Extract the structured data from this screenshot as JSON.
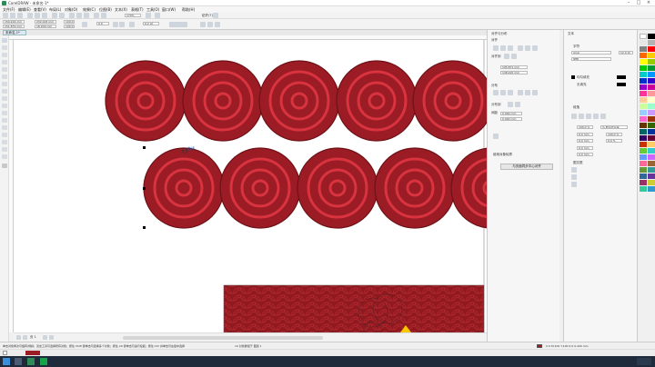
{
  "window": {
    "title": "CorelDRAW - 未命名-1*"
  },
  "menu": [
    "文件(F)",
    "编辑(E)",
    "查看(V)",
    "布局(L)",
    "对象(O)",
    "效果(C)",
    "位图(B)",
    "文本(X)",
    "表格(T)",
    "工具(O)",
    "窗口(W)",
    "帮助(H)"
  ],
  "toolbar": {
    "zoom": "170%",
    "snap_label": "贴齐(T)"
  },
  "propbar": {
    "x": "150.224 mm",
    "y": "151.879 mm",
    "w": "232.003 mm",
    "h": "18.209 mm",
    "sx": "100.0",
    "sy": "100.0",
    "angle": "0.0",
    "outline": "0.2 pt"
  },
  "document_tab": "未命名-1*",
  "canvas": {
    "tooltip": "曲线",
    "circle_fill": "#9b1c24",
    "ring_color": "#d8333f",
    "row1_count": 5,
    "row2_count": 5
  },
  "dock": {
    "title": "对齐与分布",
    "align_label": "对齐",
    "align_to_label": "对齐到",
    "distribute_label": "分布",
    "distribute_to_label": "分布到",
    "align_box1": "195.871 mm",
    "align_box2": "148.220 mm",
    "space_label": "间距",
    "dist_box1": "0.000 mm",
    "dist_box2": "0.000 mm",
    "section3": "使用对象轮廓",
    "apply_button": "与页面同步中心对齐"
  },
  "text_panel": {
    "title": "文本",
    "char_label": "字符",
    "font": "Arial",
    "size": "12.0 pt",
    "style": "常规",
    "fill1": "均匀填充",
    "fill2": "无填充",
    "para_label": "段落",
    "pct1": "100.0 %",
    "pct_label": "% 的字符高度",
    "mm1": "0.0 mm",
    "mm2": "0.0 mm",
    "pct2": "100.0 %",
    "pct3": "0.0 %",
    "mm3": "0.0 mm",
    "mm4": "0.0 mm",
    "frame_label": "图文框"
  },
  "statusbar": {
    "hint": "单击对象两次可旋转/倾斜；双击工具可选择所有对象；按住 Shift 键单击可选择多个对象；按住 Alt 键单击可进行挖掘；按住 Ctrl 并单击可在组中选择",
    "selection": "10 对象群组于 图层 1",
    "coords": "C:0 M:100 Y:100 K:0  0.200 mm"
  },
  "page_nav": {
    "page": "页 1"
  },
  "palette_colors": [
    "#ffffff",
    "#000000",
    "#e6e6e6",
    "#b3b3b3",
    "#808080",
    "#ff0000",
    "#ff6600",
    "#ffcc00",
    "#ffff00",
    "#99cc00",
    "#00cc00",
    "#009933",
    "#00cccc",
    "#0099ff",
    "#0033cc",
    "#3300cc",
    "#9900cc",
    "#cc0099",
    "#ff3399",
    "#ff9999",
    "#ffcc99",
    "#ffffcc",
    "#ccff99",
    "#99ffcc",
    "#99ccff",
    "#cc99ff",
    "#ff66cc",
    "#993300",
    "#663300",
    "#336600",
    "#006666",
    "#003399",
    "#330066",
    "#660033",
    "#cc3300",
    "#ffcc66",
    "#66cc33",
    "#33cccc",
    "#6699ff",
    "#cc66ff",
    "#ff6699",
    "#996633",
    "#669933",
    "#339999",
    "#336699",
    "#663399",
    "#993366",
    "#cccc33",
    "#33cc99",
    "#3399cc"
  ]
}
